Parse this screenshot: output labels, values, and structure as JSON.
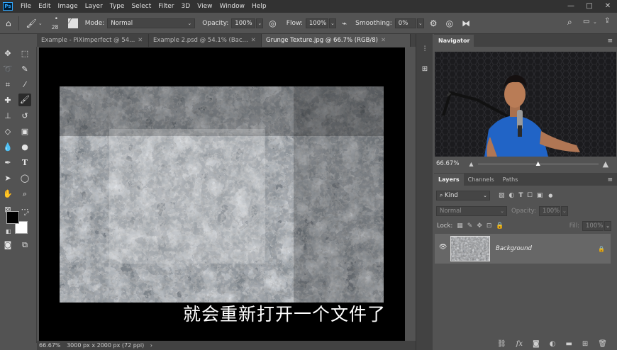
{
  "menubar": {
    "logo": "Ps",
    "items": [
      "File",
      "Edit",
      "Image",
      "Layer",
      "Type",
      "Select",
      "Filter",
      "3D",
      "View",
      "Window",
      "Help"
    ],
    "controls": [
      "—",
      "□",
      "✕"
    ]
  },
  "options_bar": {
    "brush_size": "28",
    "mode_label": "Mode:",
    "mode_value": "Normal",
    "opacity_label": "Opacity:",
    "opacity_value": "100%",
    "flow_label": "Flow:",
    "flow_value": "100%",
    "smoothing_label": "Smoothing:",
    "smoothing_value": "0%"
  },
  "tabs": [
    {
      "label": "Example - PiXimperfect @ 54...",
      "active": false
    },
    {
      "label": "Example 2.psd @ 54.1% (Bac...",
      "active": false
    },
    {
      "label": "Grunge Texture.jpg @ 66.7% (RGB/8)",
      "active": true
    }
  ],
  "subtitle": "就会重新打开一个文件了",
  "status": {
    "zoom": "66.67%",
    "doc_info": "3000 px x 2000 px (72 ppi)",
    "arrow": "›"
  },
  "navigator": {
    "title": "Navigator",
    "zoom": "66.67%"
  },
  "layers": {
    "tabs": [
      "Layers",
      "Channels",
      "Paths"
    ],
    "kind_label": "Kind",
    "blend_mode": "Normal",
    "opacity_label": "Opacity:",
    "opacity_value": "100%",
    "lock_label": "Lock:",
    "fill_label": "Fill:",
    "fill_value": "100%",
    "layer_name": "Background"
  },
  "colors": {
    "foreground": "#000000",
    "background": "#ffffff",
    "accent": "#31a8ff"
  }
}
